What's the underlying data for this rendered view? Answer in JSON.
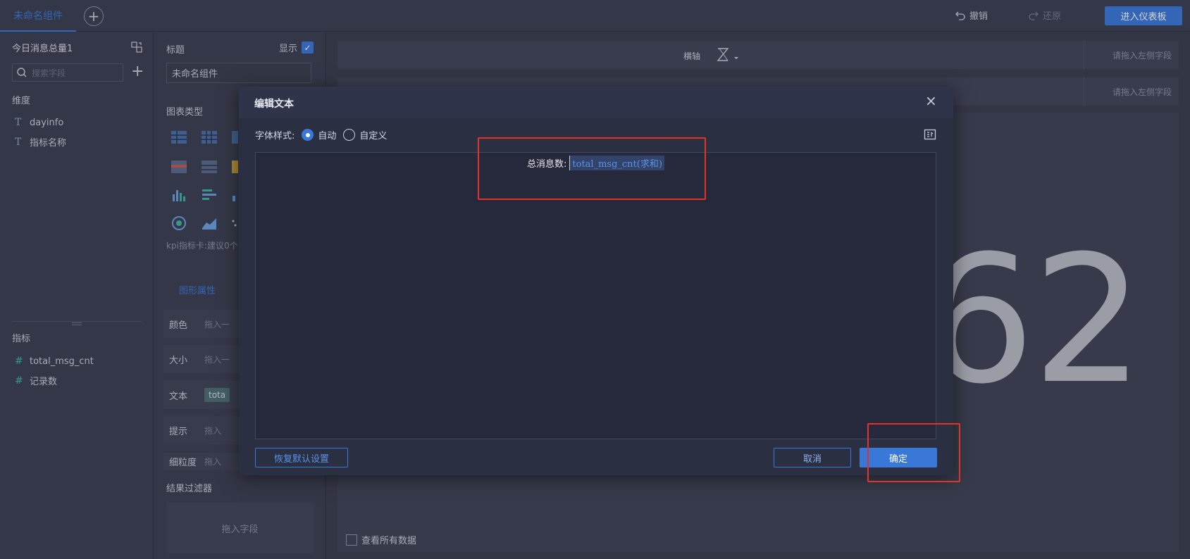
{
  "topbar": {
    "active_tab": "未命名组件",
    "add_tab_symbol": "+",
    "undo_label": "撤销",
    "redo_label": "还原",
    "dashboard_button": "进入仪表板"
  },
  "left_panel": {
    "dataset_name": "今日消息总量1",
    "search_placeholder": "搜索字段",
    "dimensions_title": "维度",
    "dimensions": [
      "dayinfo",
      "指标名称"
    ],
    "measures_title": "指标",
    "measures": [
      "total_msg_cnt",
      "记录数"
    ]
  },
  "mid_panel": {
    "title_label": "标题",
    "show_label": "显示",
    "title_value": "未命名组件",
    "chart_type_label": "图表类型",
    "kpi_hint": "kpi指标卡:建议0个",
    "attr_tab": "图形属性",
    "attrs": [
      {
        "label": "颜色",
        "drop": "拖入一"
      },
      {
        "label": "大小",
        "drop": "拖入一"
      },
      {
        "label": "文本",
        "chip": "tota"
      },
      {
        "label": "提示",
        "drop": "拖入"
      },
      {
        "label": "细粒度",
        "drop": "拖入"
      }
    ],
    "filter_title": "结果过滤器",
    "filter_drop": "拖入字段"
  },
  "canvas": {
    "x_axis_label": "横轴",
    "drop_hint_1": "请拖入左侧字段",
    "drop_hint_2": "请拖入左侧字段",
    "big_number": "62",
    "view_all_label": "查看所有数据"
  },
  "modal": {
    "title": "编辑文本",
    "close_symbol": "×",
    "font_style_label": "字体样式:",
    "radio_auto": "自动",
    "radio_custom": "自定义",
    "editor_label": "总消息数:",
    "editor_token": "total_msg_cnt(求和)",
    "reset_button": "恢复默认设置",
    "cancel_button": "取消",
    "ok_button": "确定"
  },
  "colors": {
    "accent": "#3a78d8",
    "annotation": "#e0342b",
    "panel_bg": "#3b3f50",
    "modal_bg": "#2b2f42"
  }
}
